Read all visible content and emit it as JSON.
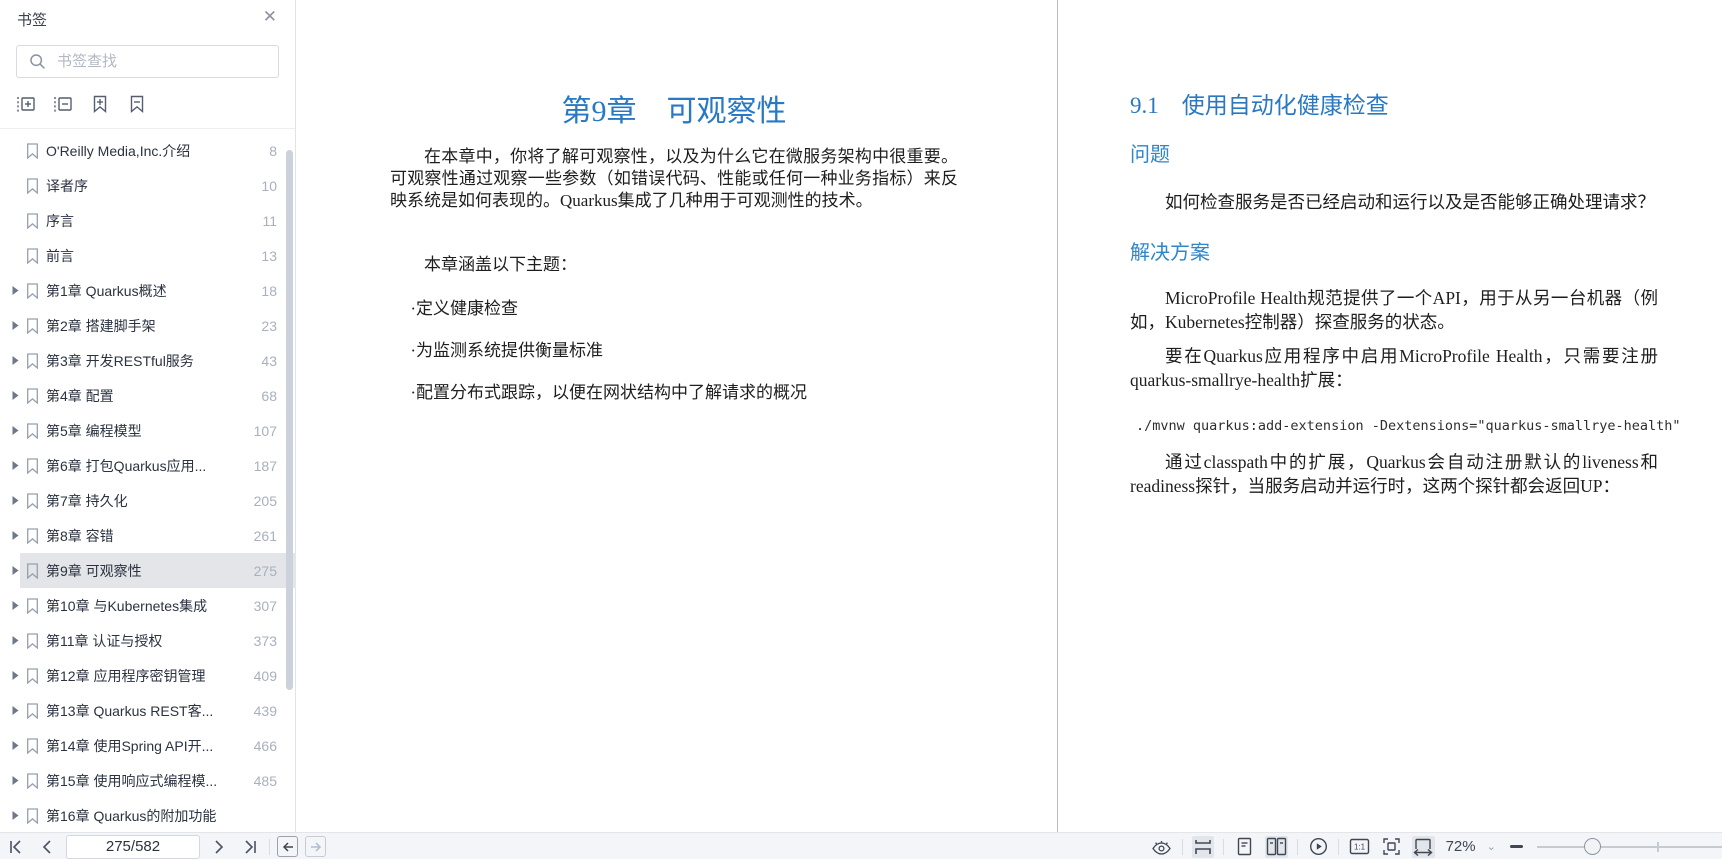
{
  "sidebar": {
    "title": "书签",
    "search_placeholder": "书签查找",
    "bookmarks": [
      {
        "label": "O'Reilly Media,Inc.介绍",
        "page": "8",
        "expandable": false,
        "selected": false
      },
      {
        "label": "译者序",
        "page": "10",
        "expandable": false,
        "selected": false
      },
      {
        "label": "序言",
        "page": "11",
        "expandable": false,
        "selected": false
      },
      {
        "label": "前言",
        "page": "13",
        "expandable": false,
        "selected": false
      },
      {
        "label": "第1章 Quarkus概述",
        "page": "18",
        "expandable": true,
        "selected": false
      },
      {
        "label": "第2章 搭建脚手架",
        "page": "23",
        "expandable": true,
        "selected": false
      },
      {
        "label": "第3章 开发RESTful服务",
        "page": "43",
        "expandable": true,
        "selected": false
      },
      {
        "label": "第4章 配置",
        "page": "68",
        "expandable": true,
        "selected": false
      },
      {
        "label": "第5章 编程模型",
        "page": "107",
        "expandable": true,
        "selected": false
      },
      {
        "label": "第6章 打包Quarkus应用...",
        "page": "187",
        "expandable": true,
        "selected": false
      },
      {
        "label": "第7章 持久化",
        "page": "205",
        "expandable": true,
        "selected": false
      },
      {
        "label": "第8章 容错",
        "page": "261",
        "expandable": true,
        "selected": false
      },
      {
        "label": "第9章 可观察性",
        "page": "275",
        "expandable": true,
        "selected": true
      },
      {
        "label": "第10章 与Kubernetes集成",
        "page": "307",
        "expandable": true,
        "selected": false
      },
      {
        "label": "第11章 认证与授权",
        "page": "373",
        "expandable": true,
        "selected": false
      },
      {
        "label": "第12章 应用程序密钥管理",
        "page": "409",
        "expandable": true,
        "selected": false
      },
      {
        "label": "第13章 Quarkus REST客...",
        "page": "439",
        "expandable": true,
        "selected": false
      },
      {
        "label": "第14章 使用Spring API开...",
        "page": "466",
        "expandable": true,
        "selected": false
      },
      {
        "label": "第15章 使用响应式编程模...",
        "page": "485",
        "expandable": true,
        "selected": false
      },
      {
        "label": "第16章 Quarkus的附加功能",
        "page": "",
        "expandable": true,
        "selected": false
      }
    ]
  },
  "left_page": {
    "chapter_title": "第9章　可观察性",
    "intro": "在本章中，你将了解可观察性，以及为什么它在微服务架构中很重要。可观察性通过观察一些参数（如错误代码、性能或任何一种业务指标）来反映系统是如何表现的。Quarkus集成了几种用于可观测性的技术。",
    "topics_lead": "本章涵盖以下主题：",
    "topics": [
      "·定义健康检查",
      "·为监测系统提供衡量标准",
      "·配置分布式跟踪，以便在网状结构中了解请求的概况"
    ]
  },
  "right_page": {
    "section_title": "9.1　使用自动化健康检查",
    "problem_heading": "问题",
    "problem_text": "如何检查服务是否已经启动和运行以及是否能够正确处理请求？",
    "solution_heading": "解决方案",
    "solution_para1": "MicroProfile Health规范提供了一个API，用于从另一台机器（例如，Kubernetes控制器）探查服务的状态。",
    "solution_para2": "要在Quarkus应用程序中启用MicroProfile Health，只需要注册quarkus-smallrye-health扩展：",
    "code": "./mvnw quarkus:add-extension -Dextensions=\"quarkus-smallrye-health\"",
    "solution_para3": "通过classpath中的扩展，Quarkus会自动注册默认的liveness和readiness探针，当服务启动并运行时，这两个探针都会返回UP："
  },
  "bottom_toolbar": {
    "page_indicator": "275/582",
    "zoom_level": "72%"
  },
  "icons": {
    "close": "✕",
    "zoom_caret": "⌄"
  },
  "colors": {
    "heading_blue": "#2878c4",
    "subheading_blue": "#2f86c9",
    "selected_row_bg": "#e3e5e9",
    "page_number_gray": "#a9b0bd",
    "toolbar_bg": "#f4f5f8",
    "icon_gray": "#3f4654"
  }
}
